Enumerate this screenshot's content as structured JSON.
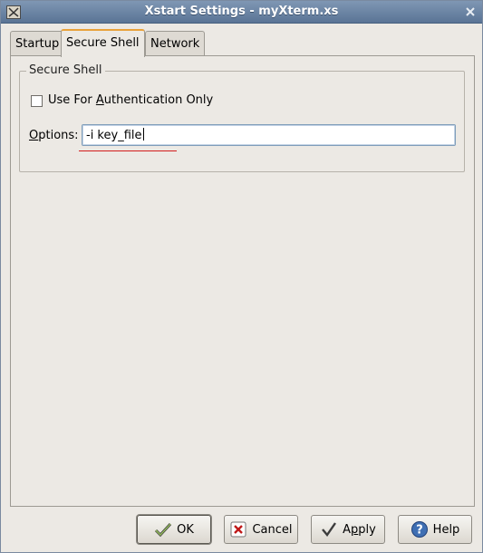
{
  "window": {
    "title": "Xstart Settings - myXterm.xs"
  },
  "tabs": [
    {
      "label": "Startup",
      "active": false
    },
    {
      "label": "Secure Shell",
      "active": true
    },
    {
      "label": "Network",
      "active": false
    }
  ],
  "secure_shell": {
    "frame_title": "Secure Shell",
    "auth_only": {
      "label_pre": "Use For ",
      "label_mnemonic": "A",
      "label_post": "uthentication Only",
      "checked": false
    },
    "options": {
      "label_mnemonic": "O",
      "label_post": "ptions:",
      "value": "-i key_file"
    }
  },
  "buttons": {
    "ok": {
      "label": "OK",
      "icon": "check-arrow-icon"
    },
    "cancel": {
      "label": "Cancel",
      "icon": "x-icon"
    },
    "apply": {
      "label_pre": "A",
      "label_mnemonic": "p",
      "label_post": "ply",
      "icon": "checkmark-icon"
    },
    "help": {
      "label": "Help",
      "icon": "question-icon"
    }
  },
  "colors": {
    "titlebar": "#6b84a4",
    "active_tab_accent": "#e9a23a",
    "spellcheck_underline": "#d21c1c"
  }
}
